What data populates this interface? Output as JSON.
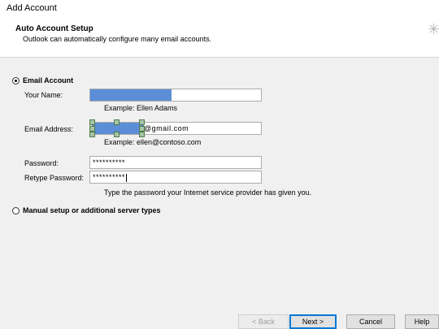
{
  "window": {
    "title": "Add Account"
  },
  "header": {
    "title": "Auto Account Setup",
    "subtitle": "Outlook can automatically configure many email accounts."
  },
  "email_option": {
    "label": "Email Account",
    "selected": true,
    "name_label": "Your Name:",
    "name_value": "",
    "name_hint": "Example: Ellen Adams",
    "email_label": "Email Address:",
    "email_value": "@gmail.com",
    "email_hint": "Example: ellen@contoso.com",
    "password_label": "Password:",
    "password_value": "**********",
    "retype_label": "Retype Password:",
    "retype_value": "**********",
    "password_hint": "Type the password your Internet service provider has given you."
  },
  "manual_option": {
    "label": "Manual setup or additional server types",
    "selected": false
  },
  "buttons": {
    "back": "< Back",
    "next": "Next >",
    "cancel": "Cancel",
    "help": "Help"
  }
}
